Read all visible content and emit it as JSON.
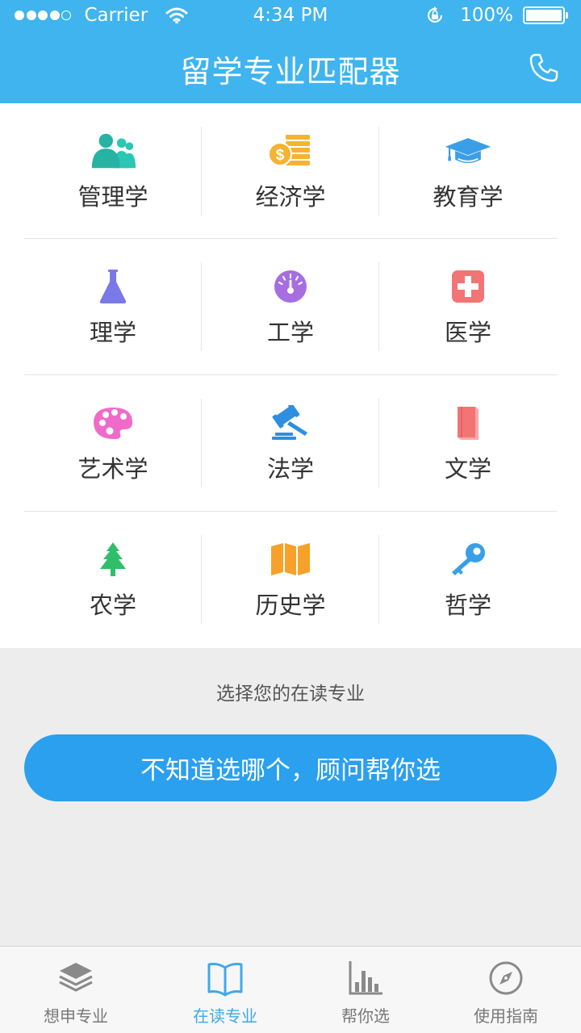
{
  "status_bar": {
    "carrier": "Carrier",
    "time": "4:34 PM",
    "battery": "100%"
  },
  "header": {
    "title": "留学专业匹配器",
    "action_icon": "phone-icon"
  },
  "majors": [
    {
      "label": "管理学",
      "icon": "people-icon",
      "color": "#2bc6b4"
    },
    {
      "label": "经济学",
      "icon": "coins-icon",
      "color": "#f4b331"
    },
    {
      "label": "教育学",
      "icon": "graduation-cap-icon",
      "color": "#3a9fe6"
    },
    {
      "label": "理学",
      "icon": "flask-icon",
      "color": "#7a79e8"
    },
    {
      "label": "工学",
      "icon": "gauge-icon",
      "color": "#a66ee0"
    },
    {
      "label": "医学",
      "icon": "medical-cross-icon",
      "color": "#f27475"
    },
    {
      "label": "艺术学",
      "icon": "palette-icon",
      "color": "#f06bc9"
    },
    {
      "label": "法学",
      "icon": "gavel-icon",
      "color": "#2e8ee0"
    },
    {
      "label": "文学",
      "icon": "book-icon",
      "color": "#f27475"
    },
    {
      "label": "农学",
      "icon": "tree-icon",
      "color": "#2fbf6a"
    },
    {
      "label": "历史学",
      "icon": "map-icon",
      "color": "#f7a12a"
    },
    {
      "label": "哲学",
      "icon": "key-icon",
      "color": "#3a9fe6"
    }
  ],
  "prompt": "选择您的在读专业",
  "cta_label": "不知道选哪个，顾问帮你选",
  "tabs": [
    {
      "label": "想申专业",
      "icon": "layers-icon",
      "active": false
    },
    {
      "label": "在读专业",
      "icon": "open-book-icon",
      "active": true
    },
    {
      "label": "帮你选",
      "icon": "bar-chart-icon",
      "active": false
    },
    {
      "label": "使用指南",
      "icon": "compass-icon",
      "active": false
    }
  ],
  "colors": {
    "header": "#3fb4ef",
    "cta": "#2aa0ee",
    "active_tab": "#3fa9e9",
    "inactive_tab": "#777777"
  }
}
